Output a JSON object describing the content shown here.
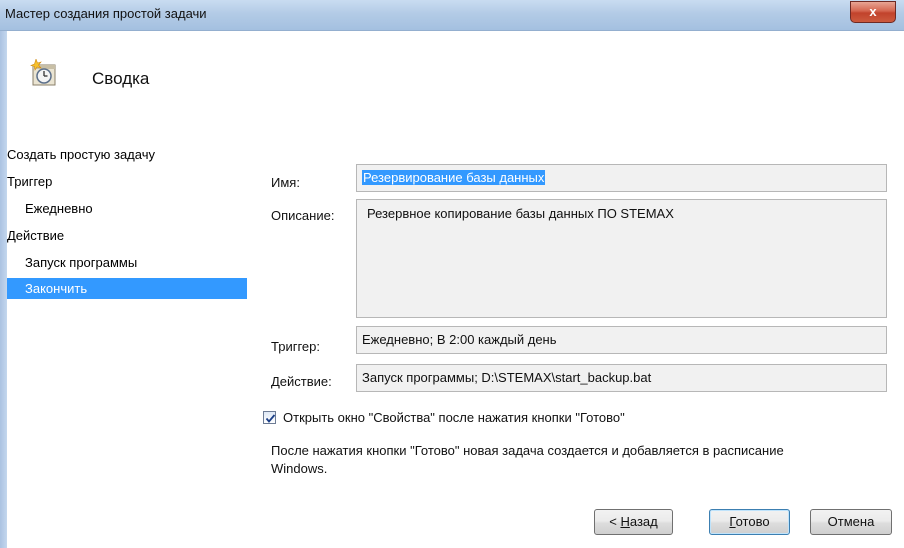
{
  "window": {
    "title": "Мастер создания простой задачи",
    "close_glyph": "x"
  },
  "header": {
    "title": "Сводка",
    "icon": "scheduled-task-clock-icon"
  },
  "nav": {
    "items": [
      {
        "label": "Создать простую задачу"
      },
      {
        "label": "Триггер"
      },
      {
        "label": "Ежедневно"
      },
      {
        "label": "Действие"
      },
      {
        "label": "Запуск программы"
      },
      {
        "label": "Закончить",
        "selected": true
      }
    ]
  },
  "form": {
    "name_label": "Имя:",
    "name_value": "Резервирование базы данных",
    "description_label": "Описание:",
    "description_value": "Резервное копирование базы данных ПО STEMAX",
    "trigger_label": "Триггер:",
    "trigger_value": "Ежедневно; В 2:00 каждый день",
    "action_label": "Действие:",
    "action_value": "Запуск программы; D:\\STEMAX\\start_backup.bat",
    "open_properties_label": "Открыть окно \"Свойства\" после нажатия кнопки \"Готово\"",
    "open_properties_checked": true,
    "info_line1": "После нажатия кнопки \"Готово\" новая задача создается и добавляется в расписание",
    "info_line2": "Windows."
  },
  "buttons": {
    "back_prefix": "< ",
    "back_accel": "Н",
    "back_rest": "азад",
    "finish_accel": "Г",
    "finish_rest": "отово",
    "cancel": "Отмена"
  },
  "colors": {
    "selection": "#3399ff",
    "titlebar": "#b3cbe6",
    "close": "#c1432c"
  }
}
